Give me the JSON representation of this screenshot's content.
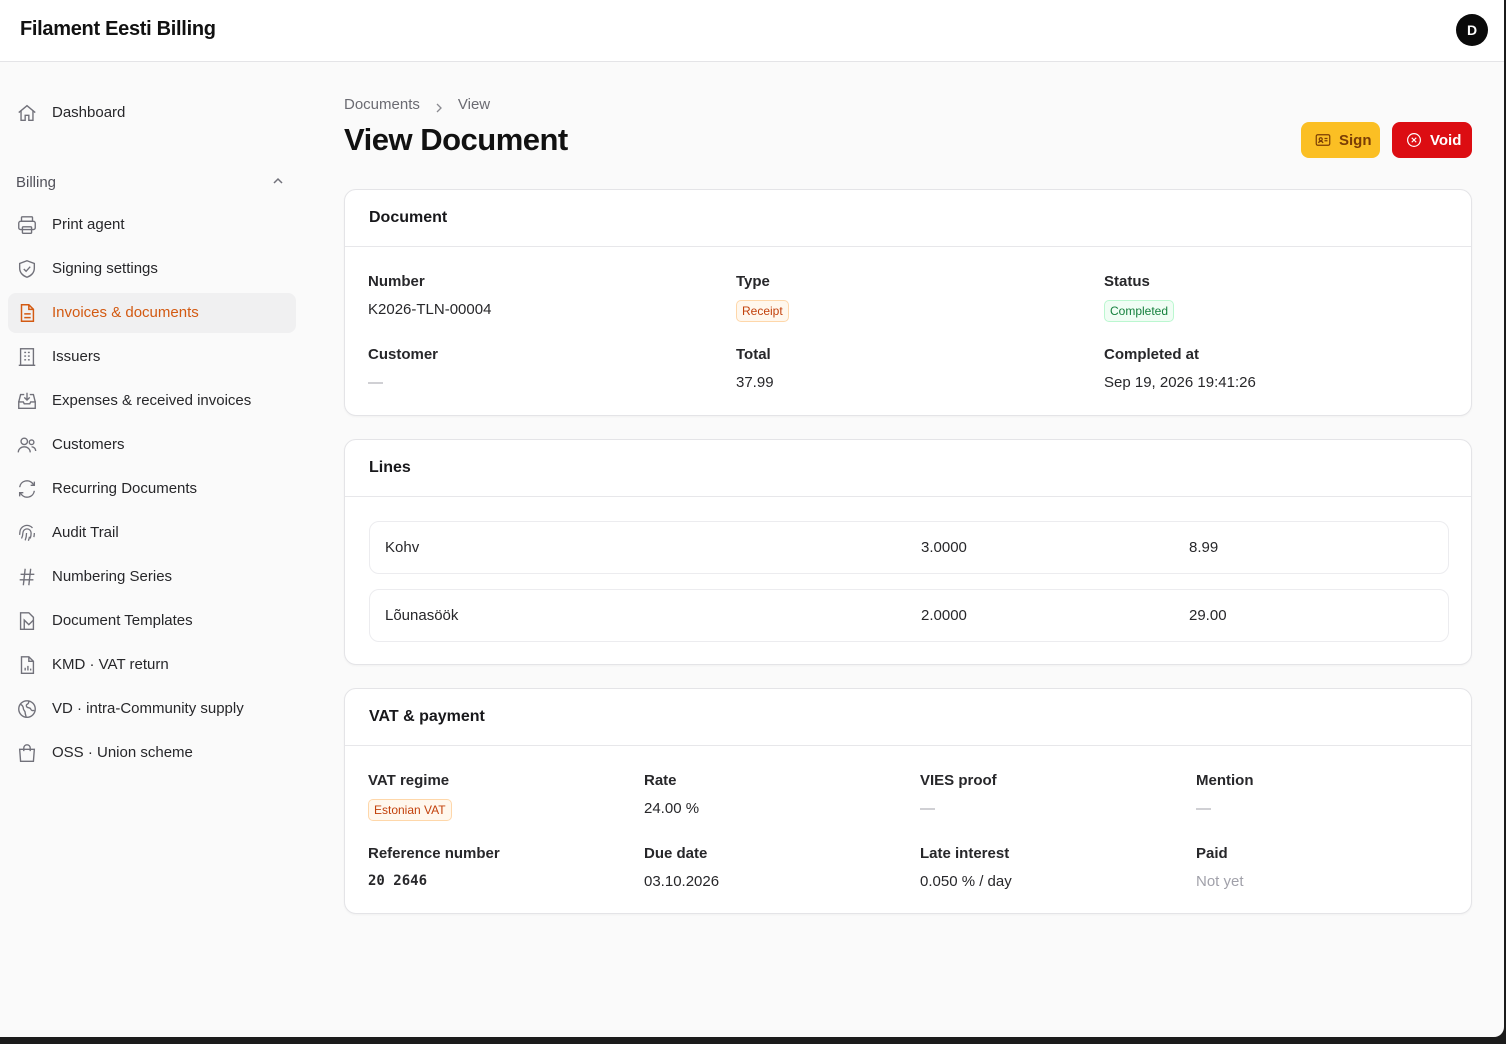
{
  "app": {
    "title": "Filament Eesti Billing",
    "avatar_initial": "D"
  },
  "sidebar": {
    "dashboard": "Dashboard",
    "group_label": "Billing",
    "items": [
      {
        "label": "Print agent",
        "icon": "printer-icon"
      },
      {
        "label": "Signing settings",
        "icon": "shield-check-icon"
      },
      {
        "label": "Invoices & documents",
        "icon": "document-icon",
        "active": true
      },
      {
        "label": "Issuers",
        "icon": "building-icon"
      },
      {
        "label": "Expenses & received invoices",
        "icon": "inbox-download-icon"
      },
      {
        "label": "Customers",
        "icon": "users-icon"
      },
      {
        "label": "Recurring Documents",
        "icon": "refresh-icon"
      },
      {
        "label": "Audit Trail",
        "icon": "fingerprint-icon"
      },
      {
        "label": "Numbering Series",
        "icon": "hashtag-icon"
      },
      {
        "label": "Document Templates",
        "icon": "document-template-icon"
      },
      {
        "label": "KMD · VAT return",
        "icon": "document-chart-icon"
      },
      {
        "label": "VD · intra-Community supply",
        "icon": "globe-icon"
      },
      {
        "label": "OSS · Union scheme",
        "icon": "shopping-bag-icon"
      }
    ]
  },
  "breadcrumb": {
    "parent": "Documents",
    "current": "View"
  },
  "page": {
    "title": "View Document"
  },
  "actions": {
    "sign": "Sign",
    "void": "Void"
  },
  "document": {
    "heading": "Document",
    "number_label": "Number",
    "number": "K2026-TLN-00004",
    "type_label": "Type",
    "type": "Receipt",
    "status_label": "Status",
    "status": "Completed",
    "customer_label": "Customer",
    "customer": "—",
    "total_label": "Total",
    "total": "37.99",
    "completed_at_label": "Completed at",
    "completed_at": "Sep 19, 2026 19:41:26"
  },
  "lines": {
    "heading": "Lines",
    "rows": [
      {
        "name": "Kohv",
        "qty": "3.0000",
        "price": "8.99"
      },
      {
        "name": "Lõunasöök",
        "qty": "2.0000",
        "price": "29.00"
      }
    ]
  },
  "vat": {
    "heading": "VAT & payment",
    "regime_label": "VAT regime",
    "regime": "Estonian VAT",
    "rate_label": "Rate",
    "rate": "24.00 %",
    "vies_label": "VIES proof",
    "vies": "—",
    "mention_label": "Mention",
    "mention": "—",
    "reference_label": "Reference number",
    "reference": "20 2646",
    "due_label": "Due date",
    "due": "03.10.2026",
    "interest_label": "Late interest",
    "interest": "0.050 % / day",
    "paid_label": "Paid",
    "paid": "Not yet"
  },
  "colors": {
    "accent": "#d35a12",
    "sign_button": "#fbbf24",
    "void_button": "#dc0d12",
    "status_ok": "#15803d",
    "badge_warn": "#c2410c"
  }
}
